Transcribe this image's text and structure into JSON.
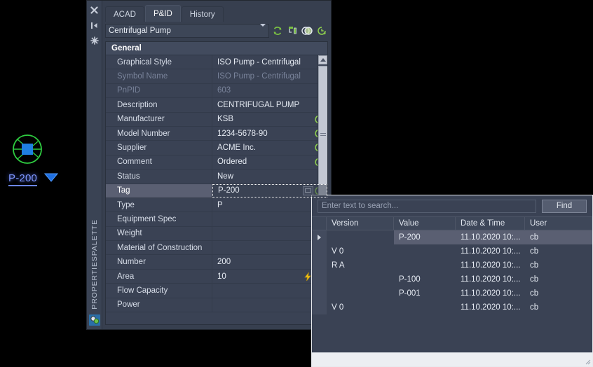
{
  "drawing": {
    "symbol_name": "centrifugal-pump-symbol",
    "label": "P-200",
    "symbol_color": "#2ecc40",
    "grip_color": "#1f7fe0",
    "label_color": "#7f97ff"
  },
  "palette": {
    "title": "PROPERTIESPALETTE",
    "side_icons": [
      "close-icon",
      "auto-hide-icon",
      "palette-properties-icon"
    ],
    "bottom_icon": "properties-palette-icon",
    "tabs": [
      {
        "label": "ACAD",
        "active": false
      },
      {
        "label": "P&ID",
        "active": true
      },
      {
        "label": "History",
        "active": false
      }
    ],
    "selector": {
      "value": "Centrifugal Pump",
      "icons": [
        "refresh-icon",
        "export-data-icon",
        "overlapping-circles-icon",
        "history-clock-icon"
      ]
    },
    "group_header": "General",
    "rows": [
      {
        "name": "Graphical Style",
        "value": "ISO Pump - Centrifugal",
        "readonly": false,
        "dropdown": true,
        "history": false,
        "state": "normal"
      },
      {
        "name": "Symbol Name",
        "value": "ISO Pump - Centrifugal",
        "readonly": true,
        "dropdown": false,
        "history": false,
        "state": "normal"
      },
      {
        "name": "PnPID",
        "value": "603",
        "readonly": true,
        "dropdown": false,
        "history": false,
        "state": "normal"
      },
      {
        "name": "Description",
        "value": "CENTRIFUGAL PUMP",
        "readonly": false,
        "dropdown": false,
        "history": false,
        "state": "normal"
      },
      {
        "name": "Manufacturer",
        "value": "KSB",
        "readonly": false,
        "dropdown": false,
        "history": true,
        "state": "normal"
      },
      {
        "name": "Model Number",
        "value": "1234-5678-90",
        "readonly": false,
        "dropdown": false,
        "history": true,
        "state": "normal"
      },
      {
        "name": "Supplier",
        "value": "ACME Inc.",
        "readonly": false,
        "dropdown": false,
        "history": true,
        "state": "normal"
      },
      {
        "name": "Comment",
        "value": "Ordered",
        "readonly": false,
        "dropdown": false,
        "history": true,
        "state": "normal"
      },
      {
        "name": "Status",
        "value": "New",
        "readonly": false,
        "dropdown": true,
        "history": false,
        "state": "normal"
      },
      {
        "name": "Tag",
        "value": "P-200",
        "readonly": false,
        "dropdown": false,
        "history": true,
        "state": "editing"
      },
      {
        "name": "Type",
        "value": "P",
        "readonly": false,
        "dropdown": true,
        "history": false,
        "state": "normal"
      },
      {
        "name": "Equipment Spec",
        "value": "",
        "readonly": false,
        "dropdown": false,
        "history": false,
        "state": "normal"
      },
      {
        "name": "Weight",
        "value": "",
        "readonly": false,
        "dropdown": false,
        "history": false,
        "state": "normal"
      },
      {
        "name": "Material of Construction",
        "value": "",
        "readonly": false,
        "dropdown": false,
        "history": false,
        "state": "normal"
      },
      {
        "name": "Number",
        "value": "200",
        "readonly": false,
        "dropdown": false,
        "history": true,
        "state": "normal"
      },
      {
        "name": "Area",
        "value": "10",
        "readonly": false,
        "dropdown": false,
        "history": true,
        "state": "normal",
        "bolt": true
      },
      {
        "name": "Flow Capacity",
        "value": "",
        "readonly": false,
        "dropdown": false,
        "history": false,
        "state": "normal"
      },
      {
        "name": "Power",
        "value": "",
        "readonly": false,
        "dropdown": false,
        "history": false,
        "state": "normal"
      }
    ]
  },
  "history_window": {
    "search_placeholder": "Enter text to search...",
    "search_value": "",
    "find_label": "Find",
    "columns": [
      "Version",
      "Value",
      "Date & Time",
      "User"
    ],
    "rows": [
      {
        "marker": true,
        "version": "",
        "value": "P-200",
        "datetime": "11.10.2020 10:...",
        "user": "cb",
        "selected": true
      },
      {
        "marker": false,
        "version": "V 0",
        "value": "",
        "datetime": "11.10.2020 10:...",
        "user": "cb",
        "selected": false
      },
      {
        "marker": false,
        "version": "R A",
        "value": "",
        "datetime": "11.10.2020 10:...",
        "user": "cb",
        "selected": false
      },
      {
        "marker": false,
        "version": "",
        "value": "P-100",
        "datetime": "11.10.2020 10:...",
        "user": "cb",
        "selected": false
      },
      {
        "marker": false,
        "version": "",
        "value": "P-001",
        "datetime": "11.10.2020 10:...",
        "user": "cb",
        "selected": false
      },
      {
        "marker": false,
        "version": "V 0",
        "value": "",
        "datetime": "11.10.2020 10:...",
        "user": "cb",
        "selected": false
      }
    ]
  }
}
